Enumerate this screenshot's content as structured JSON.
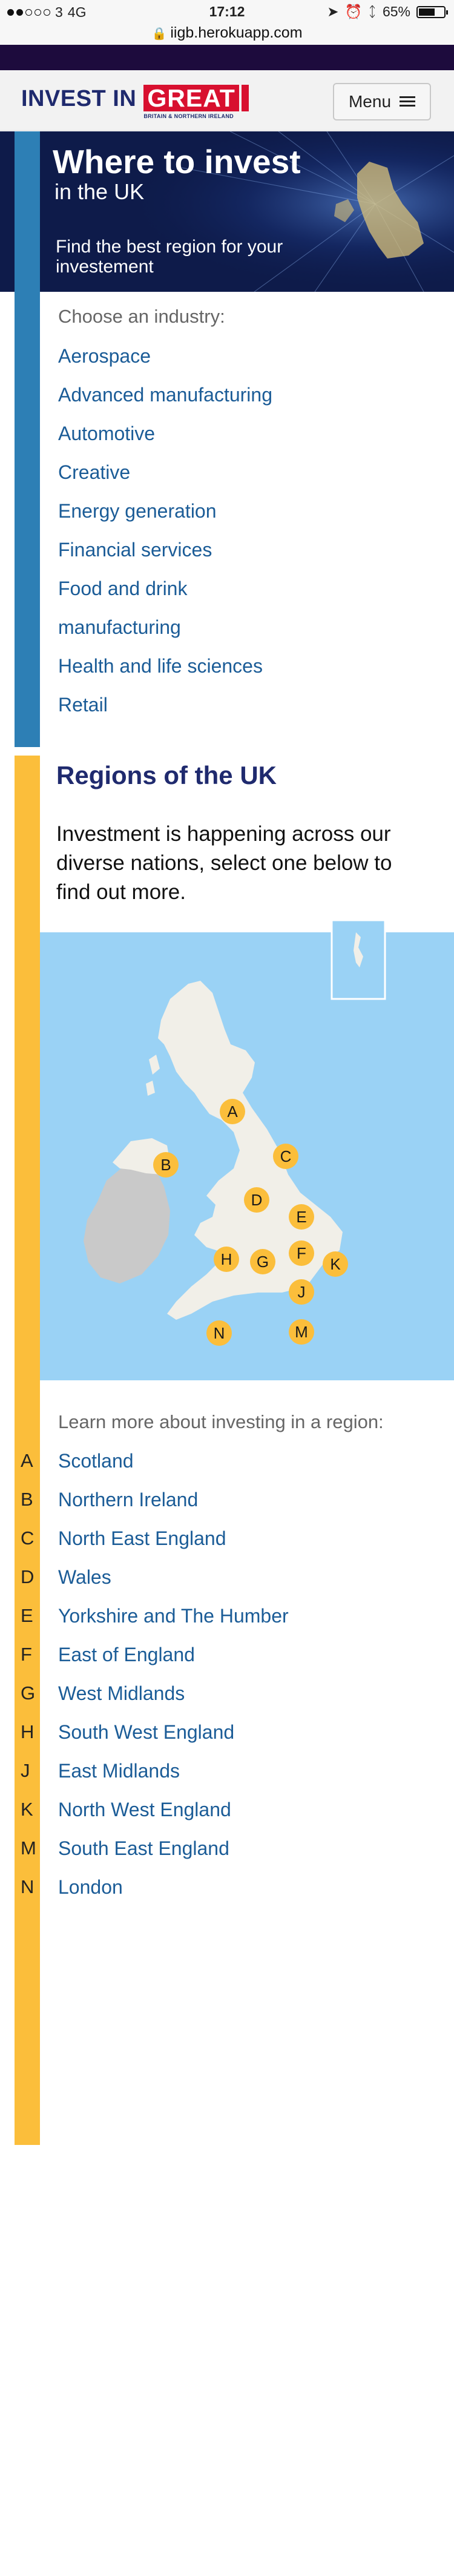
{
  "status_bar": {
    "carrier": "3",
    "network": "4G",
    "time": "17:12",
    "battery": "65%",
    "battery_level": 0.65
  },
  "browser": {
    "url": "iigb.herokuapp.com"
  },
  "header": {
    "logo_invest": "INVEST IN",
    "logo_great": "GREAT",
    "logo_tagline": "BRITAIN & NORTHERN IRELAND",
    "menu_label": "Menu"
  },
  "hero": {
    "title": "Where to invest",
    "subtitle": "in the UK",
    "text": "Find the best region for your investement"
  },
  "industries": {
    "label": "Choose an industry:",
    "items": [
      "Aerospace",
      "Advanced manufacturing",
      "Automotive",
      "Creative",
      "Energy generation",
      "Financial services",
      "Food and drink",
      "manufacturing",
      "Health and life sciences",
      "Retail"
    ]
  },
  "regions": {
    "title": "Regions of the UK",
    "intro": "Investment is happening across our diverse nations, select one below to find out more.",
    "learn_label": "Learn more about investing in a region:",
    "markers": [
      "A",
      "B",
      "C",
      "D",
      "E",
      "F",
      "G",
      "H",
      "J",
      "K",
      "M",
      "N"
    ],
    "items": [
      {
        "letter": "A",
        "name": "Scotland"
      },
      {
        "letter": "B",
        "name": "Northern Ireland"
      },
      {
        "letter": "C",
        "name": "North East England"
      },
      {
        "letter": "D",
        "name": "Wales"
      },
      {
        "letter": "E",
        "name": "Yorkshire and The Humber"
      },
      {
        "letter": "F",
        "name": "East of England"
      },
      {
        "letter": "G",
        "name": "West Midlands"
      },
      {
        "letter": "H",
        "name": "South West England"
      },
      {
        "letter": "J",
        "name": "East Midlands"
      },
      {
        "letter": "K",
        "name": "North West England"
      },
      {
        "letter": "M",
        "name": "South East England"
      },
      {
        "letter": "N",
        "name": "London"
      }
    ]
  },
  "colors": {
    "brand_navy": "#1f2a6e",
    "brand_red": "#d8102f",
    "industry_accent": "#2d7fb5",
    "region_accent": "#fbbe3b",
    "link_blue": "#1b5c97",
    "sea_blue": "#9ad2f5"
  }
}
